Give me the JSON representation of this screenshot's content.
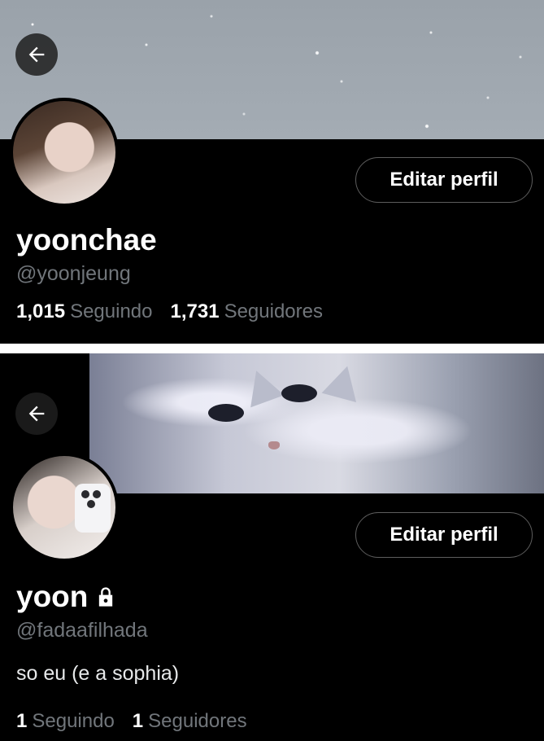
{
  "profiles": [
    {
      "display_name": "yoonchae",
      "handle": "@yoonjeung",
      "locked": false,
      "bio": "",
      "edit_label": "Editar perfil",
      "following_count": "1,015",
      "following_label": "Seguindo",
      "followers_count": "1,731",
      "followers_label": "Seguidores",
      "banner": "starry-gray-sky"
    },
    {
      "display_name": "yoon",
      "handle": "@fadaafilhada",
      "locked": true,
      "bio": "so eu (e a sophia)",
      "edit_label": "Editar perfil",
      "following_count": "1",
      "following_label": "Seguindo",
      "followers_count": "1",
      "followers_label": "Seguidores",
      "banner": "cat-with-headphones"
    }
  ],
  "icons": {
    "back": "arrow-left-icon",
    "lock": "lock-icon"
  },
  "colors": {
    "background": "#000000",
    "text_primary": "#ffffff",
    "text_secondary": "#71767b",
    "button_border": "#5d5d5d"
  }
}
